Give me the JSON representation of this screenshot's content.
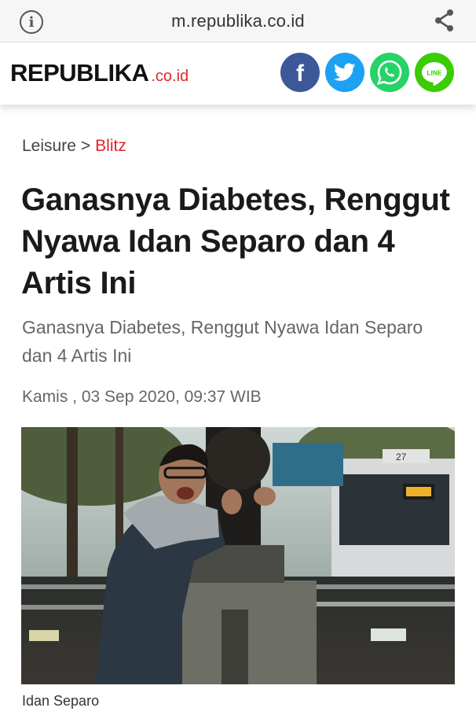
{
  "browser": {
    "url": "m.republika.co.id",
    "info_icon": "i"
  },
  "header": {
    "logo_main": "REPUBLIKA",
    "logo_suffix": ".co.id",
    "social": [
      {
        "name": "facebook",
        "glyph": "f",
        "color": "#3b5998"
      },
      {
        "name": "twitter",
        "color": "#1da1f2"
      },
      {
        "name": "whatsapp",
        "color": "#25d366"
      },
      {
        "name": "line",
        "glyph": "LINE",
        "color": "#3acd01"
      }
    ]
  },
  "article": {
    "breadcrumb": {
      "section": "Leisure",
      "separator": ">",
      "category": "Blitz"
    },
    "title": "Ganasnya Diabetes, Renggut Nyawa Idan Separo dan 4 Artis Ini",
    "subtitle": "Ganasnya Diabetes, Renggut Nyawa Idan Separo dan 4 Artis Ini",
    "date": "Kamis , 03 Sep 2020, 09:37 WIB",
    "image_caption": "Idan Separo",
    "accent_color": "#e0262b",
    "photo_signage": [
      "27"
    ]
  }
}
